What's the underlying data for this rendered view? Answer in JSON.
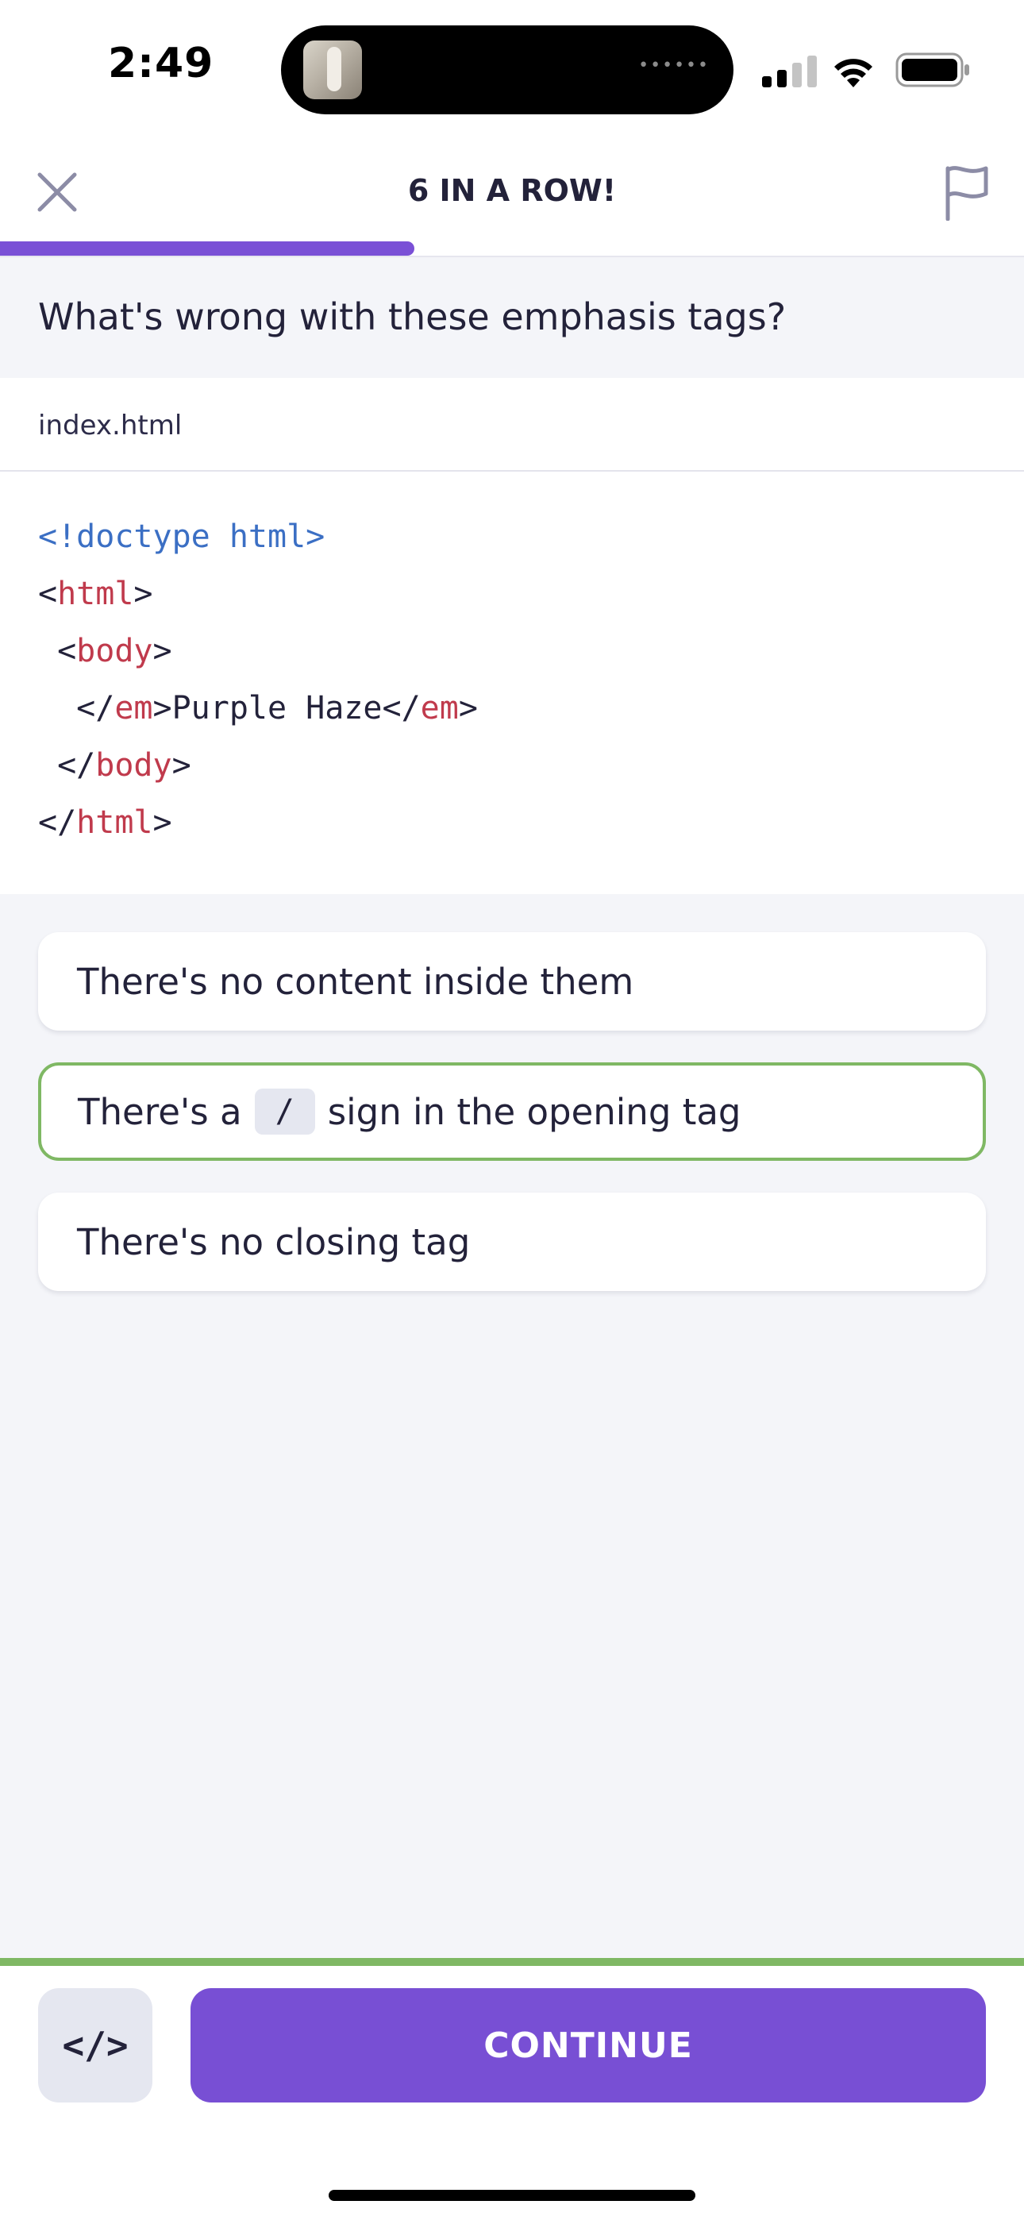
{
  "status_bar": {
    "time": "2:49"
  },
  "header": {
    "streak_label": "6 IN A ROW!",
    "progress": 0.405
  },
  "question": "What's wrong with these emphasis tags?",
  "code": {
    "filename": "index.html",
    "lines": [
      [
        {
          "t": "<!doctype html>",
          "c": "doc"
        }
      ],
      [
        {
          "t": "<",
          "c": "p"
        },
        {
          "t": "html",
          "c": "tag"
        },
        {
          "t": ">",
          "c": "p"
        }
      ],
      [
        {
          "t": " <",
          "c": "p"
        },
        {
          "t": "body",
          "c": "tag"
        },
        {
          "t": ">",
          "c": "p"
        }
      ],
      [
        {
          "t": "  </",
          "c": "p"
        },
        {
          "t": "em",
          "c": "tag"
        },
        {
          "t": ">Purple Haze</",
          "c": "p"
        },
        {
          "t": "em",
          "c": "tag"
        },
        {
          "t": ">",
          "c": "p"
        }
      ],
      [
        {
          "t": " </",
          "c": "p"
        },
        {
          "t": "body",
          "c": "tag"
        },
        {
          "t": ">",
          "c": "p"
        }
      ],
      [
        {
          "t": "</",
          "c": "p"
        },
        {
          "t": "html",
          "c": "tag"
        },
        {
          "t": ">",
          "c": "p"
        }
      ]
    ]
  },
  "options": {
    "opt1": "There's no content inside them",
    "opt2_before": "There's a",
    "opt2_code": "/",
    "opt2_after": "sign in the opening tag",
    "opt3": "There's no closing tag",
    "selected": 2
  },
  "footer": {
    "code_button": "</>",
    "continue_label": "CONTINUE"
  },
  "colors": {
    "accent": "#784fd4",
    "correct": "#7fb864",
    "tag": "#c03a4c",
    "doctype": "#3b6fc4"
  }
}
